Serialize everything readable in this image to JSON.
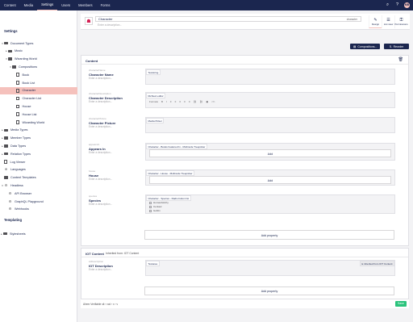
{
  "topnav": {
    "items": [
      "Content",
      "Media",
      "Settings",
      "Users",
      "Members",
      "Forms"
    ],
    "active": 2,
    "avatar": "MB"
  },
  "sidebar": {
    "title": "Settings",
    "items": [
      {
        "label": "Document Types",
        "depth": 0,
        "icon": "folder",
        "caret": "down"
      },
      {
        "label": "Music",
        "depth": 1,
        "icon": "folder",
        "caret": "right"
      },
      {
        "label": "Wizarding World",
        "depth": 1,
        "icon": "folder",
        "caret": "down"
      },
      {
        "label": "Compositions",
        "depth": 2,
        "icon": "folder",
        "caret": "down"
      },
      {
        "label": "Book",
        "depth": 3,
        "icon": "doc"
      },
      {
        "label": "Book List",
        "depth": 3,
        "icon": "doc"
      },
      {
        "label": "Character",
        "depth": 3,
        "icon": "doc",
        "selected": true
      },
      {
        "label": "Character List",
        "depth": 3,
        "icon": "doc"
      },
      {
        "label": "House",
        "depth": 3,
        "icon": "doc"
      },
      {
        "label": "House List",
        "depth": 3,
        "icon": "doc"
      },
      {
        "label": "Wizarding World",
        "depth": 3,
        "icon": "doc"
      },
      {
        "label": "Media Types",
        "depth": 0,
        "icon": "folder",
        "caret": "right"
      },
      {
        "label": "Member Types",
        "depth": 0,
        "icon": "folder",
        "caret": "right"
      },
      {
        "label": "Data Types",
        "depth": 0,
        "icon": "folder",
        "caret": "right"
      },
      {
        "label": "Relation Types",
        "depth": 0,
        "icon": "folder",
        "caret": "right"
      },
      {
        "label": "Log Viewer",
        "depth": 0,
        "icon": "doc"
      },
      {
        "label": "Languages",
        "depth": 0,
        "icon": "globe"
      },
      {
        "label": "Content Templates",
        "depth": 0,
        "icon": "folder"
      },
      {
        "label": "Headless",
        "depth": 0,
        "icon": "gear",
        "caret": "down"
      },
      {
        "label": "API Browser",
        "depth": 1,
        "icon": "gear"
      },
      {
        "label": "GraphQL Playground",
        "depth": 1,
        "icon": "gear"
      },
      {
        "label": "Webhooks",
        "depth": 1,
        "icon": "gear"
      }
    ],
    "templating_title": "Templating",
    "stylesheets": "Stylesheets"
  },
  "header": {
    "name": "Character",
    "alias": "character",
    "description_placeholder": "Enter a description...",
    "apps": [
      {
        "label": "Design",
        "icon": "✎",
        "active": true
      },
      {
        "label": "List view",
        "icon": "☰"
      },
      {
        "label": "Permissions",
        "icon": "⚿"
      }
    ]
  },
  "toolbar": {
    "compositions": "Compositions...",
    "reorder": "Reorder"
  },
  "content_group": {
    "title": "Content",
    "properties": [
      {
        "alias": "characterName",
        "label": "Character Name",
        "desc": "Enter a description...",
        "editor": "Textstring"
      },
      {
        "alias": "characterDescription",
        "label": "Character Description",
        "desc": "Enter a description...",
        "editor": "Richtext editor",
        "toolbar": [
          "Formats",
          "B",
          "I",
          "≡",
          "≡",
          "≡",
          "≡",
          "≡",
          "⛓",
          "⛓",
          "▣",
          "</>"
        ]
      },
      {
        "alias": "characterPicture",
        "label": "Character Picture",
        "desc": "Enter a description...",
        "editor": "Media Picker"
      },
      {
        "alias": "appearsIn",
        "label": "Appears In",
        "desc": "Enter a description...",
        "editor": "Character - Books Featured In - Multinode Treepicker",
        "add": "Add"
      },
      {
        "alias": "house",
        "label": "House",
        "desc": "Enter a description...",
        "editor": "Character - House - Multinode Treepicker",
        "add": "Add"
      },
      {
        "alias": "species",
        "label": "Species",
        "desc": "Enter a description...",
        "editor": "Character - Species - Radio button list",
        "options": [
          "Human/witchy",
          "Centaur",
          "Goblin"
        ]
      }
    ],
    "add_property": "Add property"
  },
  "iot_group": {
    "title": "IOT Content",
    "inherited": "Inherited from: IOT Content",
    "properties": [
      {
        "alias": "iotDescription",
        "label": "IOT Description",
        "desc": "Enter a description...",
        "editor": "Textarea",
        "inherited_tag": "is inherited from IOT Content"
      }
    ],
    "add_property": "Add property"
  },
  "footer": {
    "breadcrumb": "Ahem Verifiable",
    "crumb_path": [
      "sit",
      "vcd",
      "x",
      "v"
    ],
    "save": "Save"
  }
}
